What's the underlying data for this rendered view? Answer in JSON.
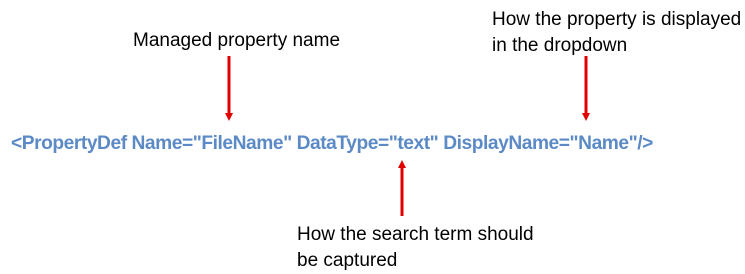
{
  "annotations": {
    "managed_property": "Managed property name",
    "displayed_line1": "How the property is displayed",
    "displayed_line2": "in the dropdown",
    "search_line1": "How the search term should",
    "search_line2": "be captured"
  },
  "code": {
    "text": "<PropertyDef Name=\"FileName\" DataType=\"text\" DisplayName=\"Name\"/>"
  },
  "colors": {
    "code_text": "#5b8ac6",
    "arrow": "#e00000",
    "annotation_text": "#000000"
  }
}
